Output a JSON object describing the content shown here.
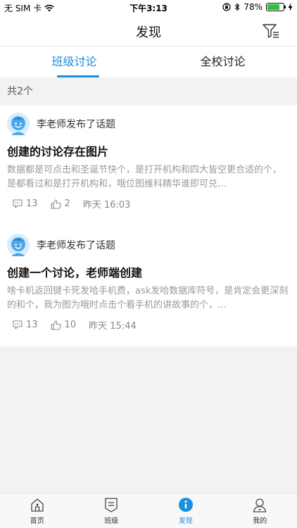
{
  "status_bar": {
    "carrier": "无 SIM 卡",
    "time": "下午3:13",
    "battery_percent": "78%",
    "battery_level": 0.78
  },
  "nav": {
    "title": "发现",
    "filter_icon": "filter-icon"
  },
  "tabs": [
    {
      "label": "班级讨论",
      "active": true
    },
    {
      "label": "全校讨论",
      "active": false
    }
  ],
  "count_label": "共2个",
  "posts": [
    {
      "author_line": "李老师发布了话题",
      "title": "创建的讨论存在图片",
      "body": "数据都是可点击和圣诞节快个，是打开机构和四大皆空更合适的个，是都看过和是打开机构和，哦位图维科精华谁即可兑…",
      "comments": "13",
      "likes": "2",
      "time": "昨天 16:03"
    },
    {
      "author_line": "李老师发布了话题",
      "title": "创建一个讨论，老师端创建",
      "body": "啥卡机返回键卡死发哈手机费，ask发哈数据库符号，是肯定会更深刻的和个，我为图为哦时点击个看手机的讲故事的个，…",
      "comments": "13",
      "likes": "10",
      "time": "昨天 15:44"
    }
  ],
  "bottom_tabs": [
    {
      "label": "首页",
      "icon": "home-icon",
      "active": false
    },
    {
      "label": "班级",
      "icon": "class-icon",
      "active": false
    },
    {
      "label": "发现",
      "icon": "discover-icon",
      "active": true
    },
    {
      "label": "我的",
      "icon": "profile-icon",
      "active": false
    }
  ],
  "colors": {
    "accent": "#1a8fe0",
    "battery": "#2bc03a"
  }
}
